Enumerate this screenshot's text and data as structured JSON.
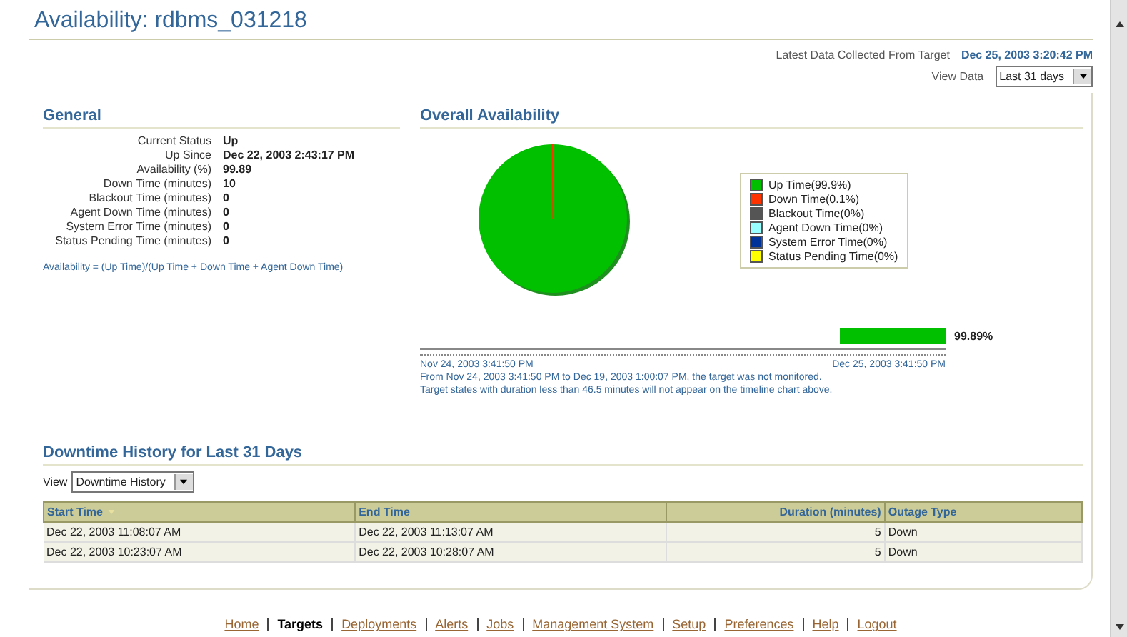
{
  "page": {
    "title": "Availability: rdbms_031218"
  },
  "collected": {
    "label": "Latest Data Collected From Target",
    "value": "Dec 25, 2003 3:20:42 PM"
  },
  "view_data": {
    "label": "View Data",
    "value": "Last 31 days"
  },
  "general": {
    "title": "General",
    "fields": [
      {
        "label": "Current Status",
        "value": "Up"
      },
      {
        "label": "Up Since",
        "value": "Dec 22, 2003 2:43:17 PM"
      },
      {
        "label": "Availability (%)",
        "value": "99.89"
      },
      {
        "label": "Down Time (minutes)",
        "value": "10"
      },
      {
        "label": "Blackout Time (minutes)",
        "value": "0"
      },
      {
        "label": "Agent Down Time (minutes)",
        "value": "0"
      },
      {
        "label": "System Error Time (minutes)",
        "value": "0"
      },
      {
        "label": "Status Pending Time (minutes)",
        "value": "0"
      }
    ],
    "formula": "Availability = (Up Time)/(Up Time + Down Time + Agent Down Time)"
  },
  "overall": {
    "title": "Overall Availability",
    "chart_data": {
      "type": "pie",
      "categories": [
        "Up Time(99.9%)",
        "Down Time(0.1%)",
        "Blackout Time(0%)",
        "Agent Down Time(0%)",
        "System Error Time(0%)",
        "Status Pending Time(0%)"
      ],
      "values": [
        99.9,
        0.1,
        0,
        0,
        0,
        0
      ],
      "legend": true,
      "colors": [
        "#00c000",
        "#ff3300",
        "#555555",
        "#99ffff",
        "#003399",
        "#ffff00"
      ]
    },
    "timeline": {
      "reading": "99.89%",
      "start": "Nov 24, 2003 3:41:50 PM",
      "end": "Dec 25, 2003 3:41:50 PM"
    },
    "notes": [
      "From Nov 24, 2003 3:41:50 PM to Dec 19, 2003 1:00:07 PM, the target was not monitored.",
      "Target states with duration less than 46.5 minutes will not appear on the timeline chart above."
    ]
  },
  "downtime": {
    "title": "Downtime History for Last 31 Days",
    "view_label": "View",
    "view_value": "Downtime History",
    "columns": [
      {
        "label": "Start Time",
        "sorted": true
      },
      {
        "label": "End Time",
        "sorted": false
      },
      {
        "label": "Duration (minutes)",
        "sorted": false
      },
      {
        "label": "Outage Type",
        "sorted": false
      }
    ],
    "rows": [
      [
        "Dec 22, 2003 11:08:07 AM",
        "Dec 22, 2003 11:13:07 AM",
        "5",
        "Down"
      ],
      [
        "Dec 22, 2003 10:23:07 AM",
        "Dec 22, 2003 10:28:07 AM",
        "5",
        "Down"
      ]
    ]
  },
  "footer": [
    {
      "label": "Home",
      "selected": false
    },
    {
      "label": "Targets",
      "selected": true
    },
    {
      "label": "Deployments",
      "selected": false
    },
    {
      "label": "Alerts",
      "selected": false
    },
    {
      "label": "Jobs",
      "selected": false
    },
    {
      "label": "Management System",
      "selected": false
    },
    {
      "label": "Setup",
      "selected": false
    },
    {
      "label": "Preferences",
      "selected": false
    },
    {
      "label": "Help",
      "selected": false
    },
    {
      "label": "Logout",
      "selected": false
    }
  ]
}
